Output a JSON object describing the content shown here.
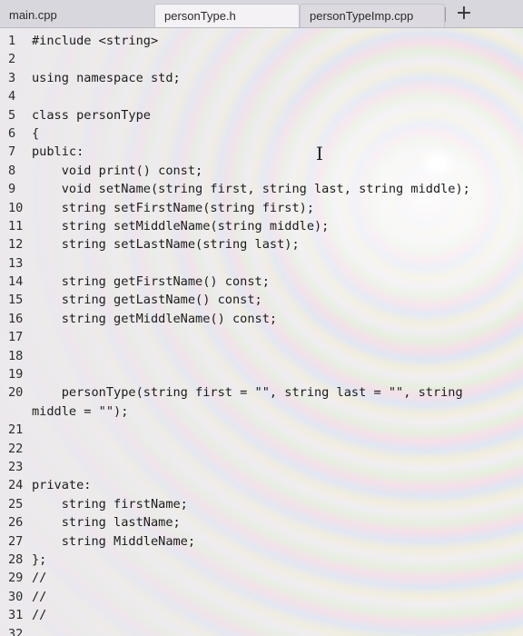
{
  "tabs": [
    {
      "label": "main.cpp",
      "active": false
    },
    {
      "label": "personType.h",
      "active": true
    },
    {
      "label": "personTypeImp.cpp",
      "active": false
    }
  ],
  "add_tab_label": "+",
  "editor": {
    "lines": [
      {
        "n": "1",
        "code": "#include <string>"
      },
      {
        "n": "2",
        "code": ""
      },
      {
        "n": "3",
        "code": "using namespace std;"
      },
      {
        "n": "4",
        "code": ""
      },
      {
        "n": "5",
        "code": "class personType"
      },
      {
        "n": "6",
        "code": "{"
      },
      {
        "n": "7",
        "code": "public:"
      },
      {
        "n": "8",
        "code": "    void print() const;"
      },
      {
        "n": "9",
        "code": "    void setName(string first, string last, string middle);"
      },
      {
        "n": "10",
        "code": "    string setFirstName(string first);"
      },
      {
        "n": "11",
        "code": "    string setMiddleName(string middle);"
      },
      {
        "n": "12",
        "code": "    string setLastName(string last);"
      },
      {
        "n": "13",
        "code": ""
      },
      {
        "n": "14",
        "code": "    string getFirstName() const;"
      },
      {
        "n": "15",
        "code": "    string getLastName() const;"
      },
      {
        "n": "16",
        "code": "    string getMiddleName() const;"
      },
      {
        "n": "17",
        "code": ""
      },
      {
        "n": "18",
        "code": ""
      },
      {
        "n": "19",
        "code": ""
      },
      {
        "n": "20",
        "code": "    personType(string first = \"\", string last = \"\", string",
        "code2": "middle = \"\");"
      },
      {
        "n": "21",
        "code": ""
      },
      {
        "n": "22",
        "code": ""
      },
      {
        "n": "23",
        "code": ""
      },
      {
        "n": "24",
        "code": "private:"
      },
      {
        "n": "25",
        "code": "    string firstName;"
      },
      {
        "n": "26",
        "code": "    string lastName;"
      },
      {
        "n": "27",
        "code": "    string MiddleName;"
      },
      {
        "n": "28",
        "code": "};"
      },
      {
        "n": "29",
        "code": "//"
      },
      {
        "n": "30",
        "code": "//"
      },
      {
        "n": "31",
        "code": "//"
      },
      {
        "n": "32",
        "code": ""
      }
    ]
  }
}
